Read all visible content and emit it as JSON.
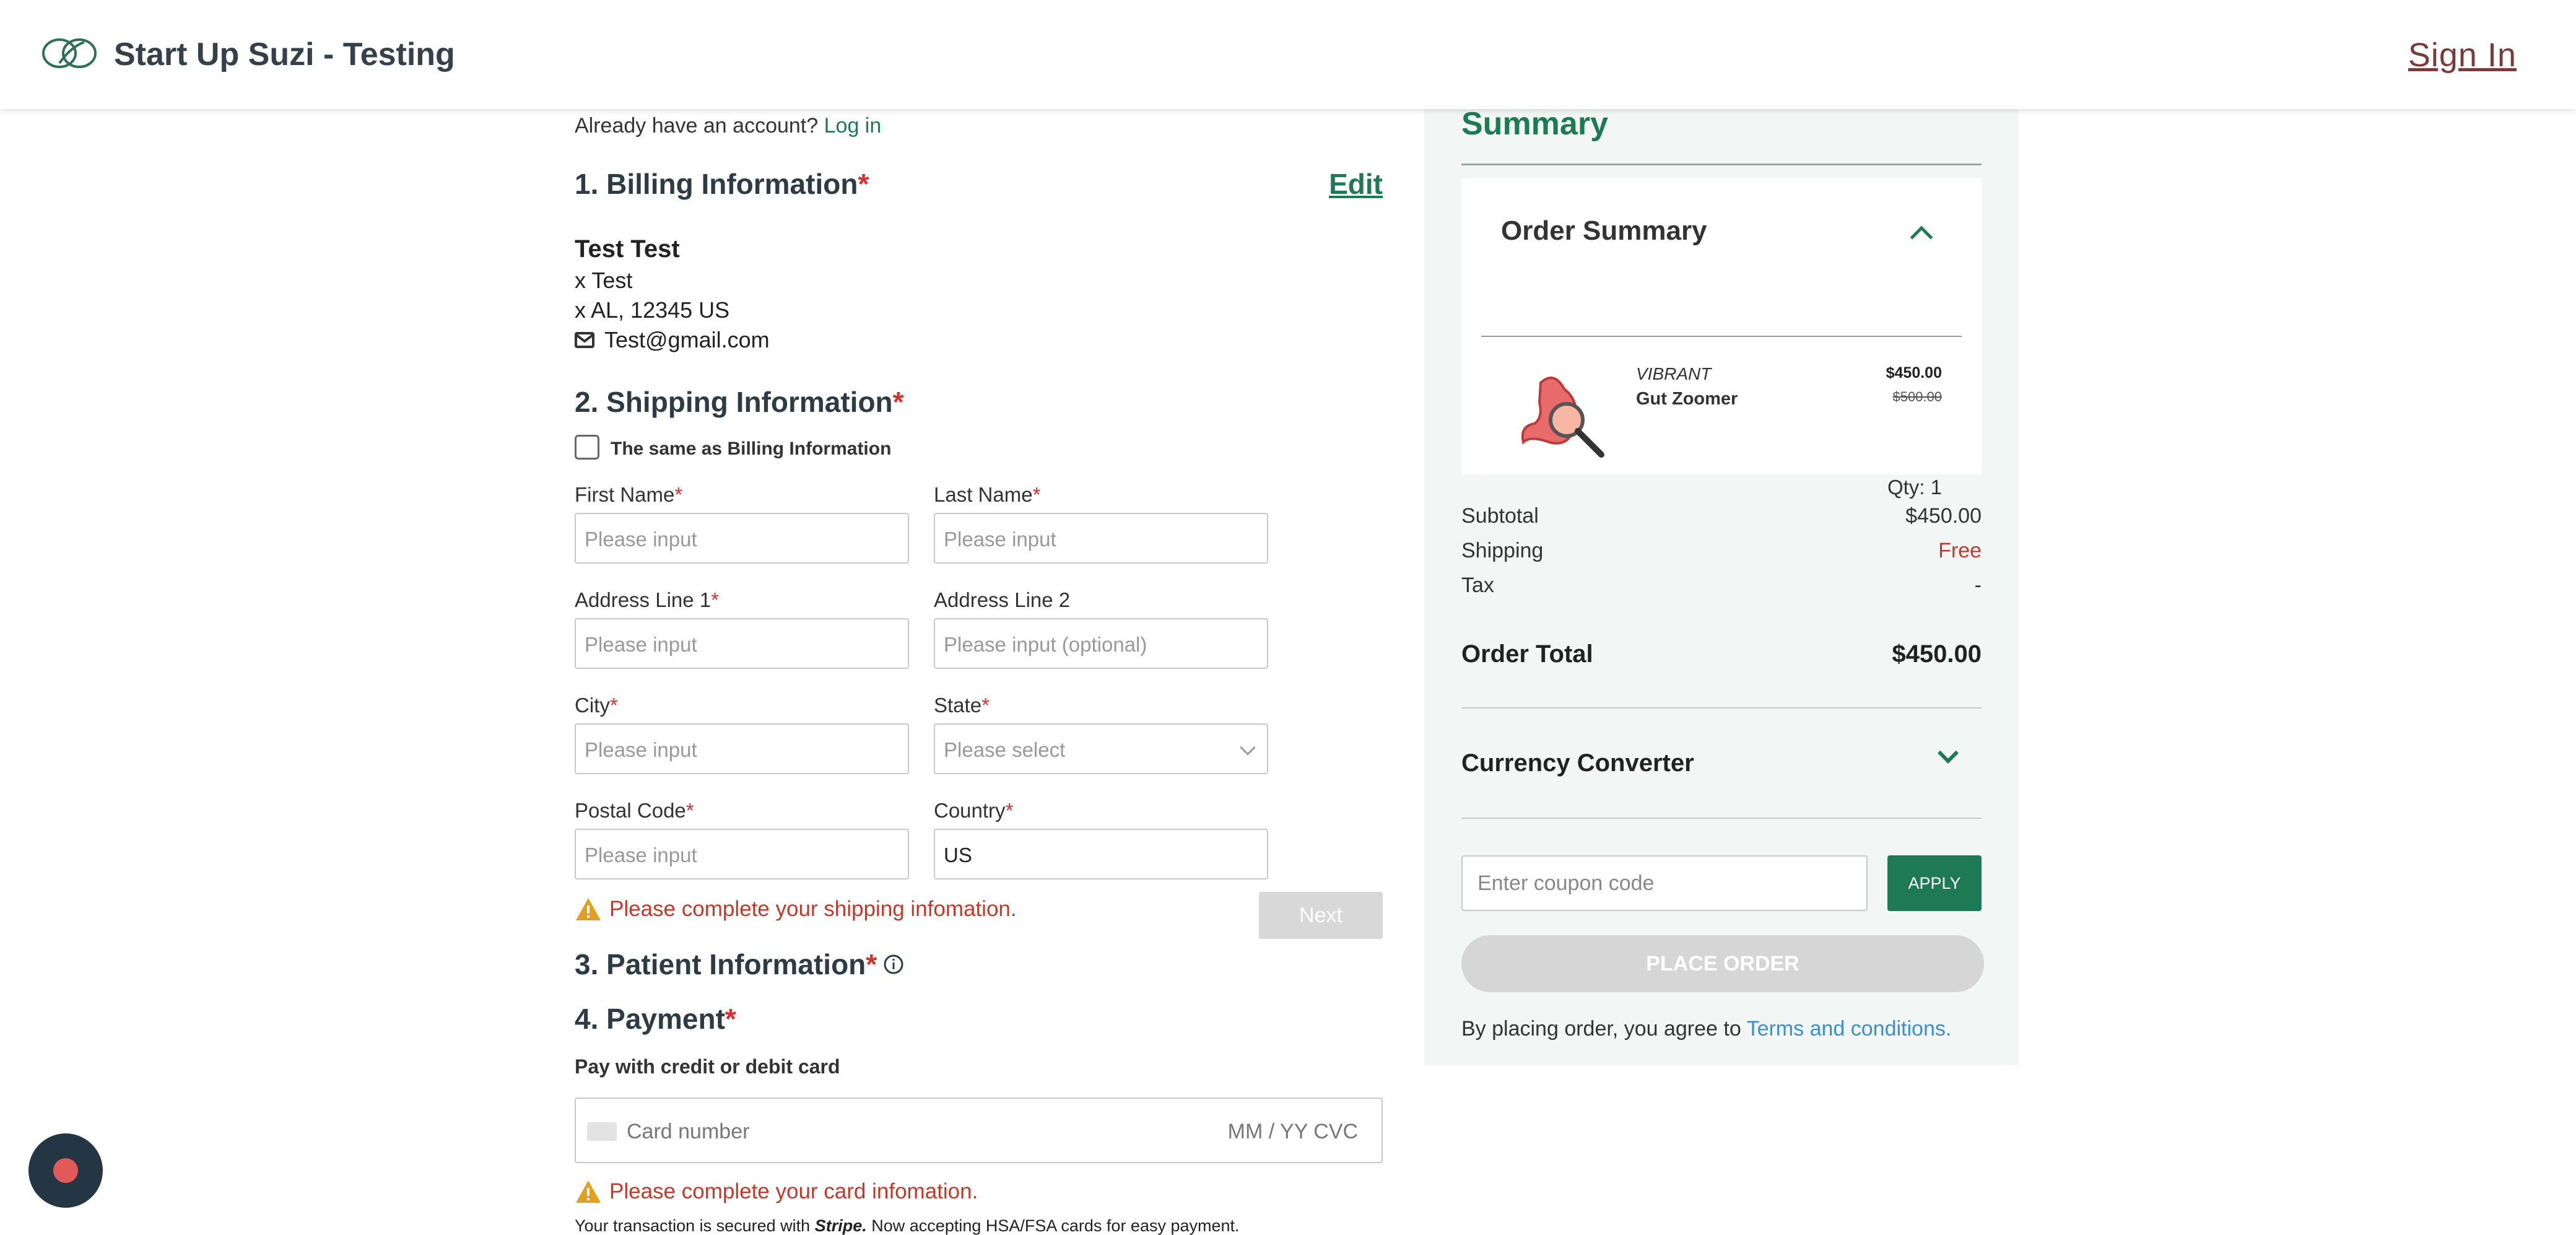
{
  "header": {
    "app_title": "Start Up Suzi - Testing",
    "sign_in": "Sign In",
    "logo_icon": "leaf-logo-icon"
  },
  "account": {
    "prompt": "Already have an account?",
    "login_link": "Log in"
  },
  "billing": {
    "title": "1. Billing Information",
    "required_mark": "*",
    "edit_label": "Edit",
    "name": "Test Test",
    "address1": "x Test",
    "address2": "x AL, 12345 US",
    "email": "Test@gmail.com"
  },
  "shipping": {
    "title": "2. Shipping Information",
    "required_mark": "*",
    "same_as_billing": "The same as Billing Information",
    "fields": {
      "first_name": {
        "label": "First Name",
        "placeholder": "Please input"
      },
      "last_name": {
        "label": "Last Name",
        "placeholder": "Please input"
      },
      "address1": {
        "label": "Address Line 1",
        "placeholder": "Please input"
      },
      "address2": {
        "label": "Address Line 2",
        "placeholder": "Please input (optional)"
      },
      "city": {
        "label": "City",
        "placeholder": "Please input"
      },
      "state": {
        "label": "State",
        "placeholder": "Please select"
      },
      "postal": {
        "label": "Postal Code",
        "placeholder": "Please input"
      },
      "country": {
        "label": "Country",
        "value": "US"
      }
    },
    "warning": "Please complete your shipping infomation.",
    "next_label": "Next"
  },
  "patient": {
    "title": "3. Patient Information",
    "required_mark": "*"
  },
  "payment": {
    "title": "4. Payment",
    "required_mark": "*",
    "subtitle": "Pay with credit or debit card",
    "card_placeholder": "Card number",
    "card_right": "MM / YY  CVC",
    "warning": "Please complete your card infomation.",
    "secured_prefix": "Your transaction is secured with",
    "secured_brand": "Stripe.",
    "secured_suffix": "Now accepting HSA/FSA cards for easy payment."
  },
  "summary": {
    "title": "Summary",
    "order_summary": "Order Summary",
    "product": {
      "brand": "VIBRANT",
      "name": "Gut Zoomer",
      "price": "$450.00",
      "old_price": "$500.00",
      "qty": "Qty: 1"
    },
    "subtotal_label": "Subtotal",
    "subtotal_value": "$450.00",
    "shipping_label": "Shipping",
    "shipping_value": "Free",
    "tax_label": "Tax",
    "tax_value": "-",
    "total_label": "Order Total",
    "total_value": "$450.00",
    "currency_converter": "Currency Converter",
    "coupon_placeholder": "Enter coupon code",
    "apply_label": "APPLY",
    "place_order_label": "PLACE ORDER",
    "agree_text": "By placing order, you agree to",
    "terms_link": "Terms and conditions."
  },
  "colors": {
    "brand_green": "#1e7a55",
    "error_red": "#c0392b",
    "required_red": "#d23232",
    "panel_bg": "#f2f7f5",
    "link_blue": "#3a8fd1"
  }
}
